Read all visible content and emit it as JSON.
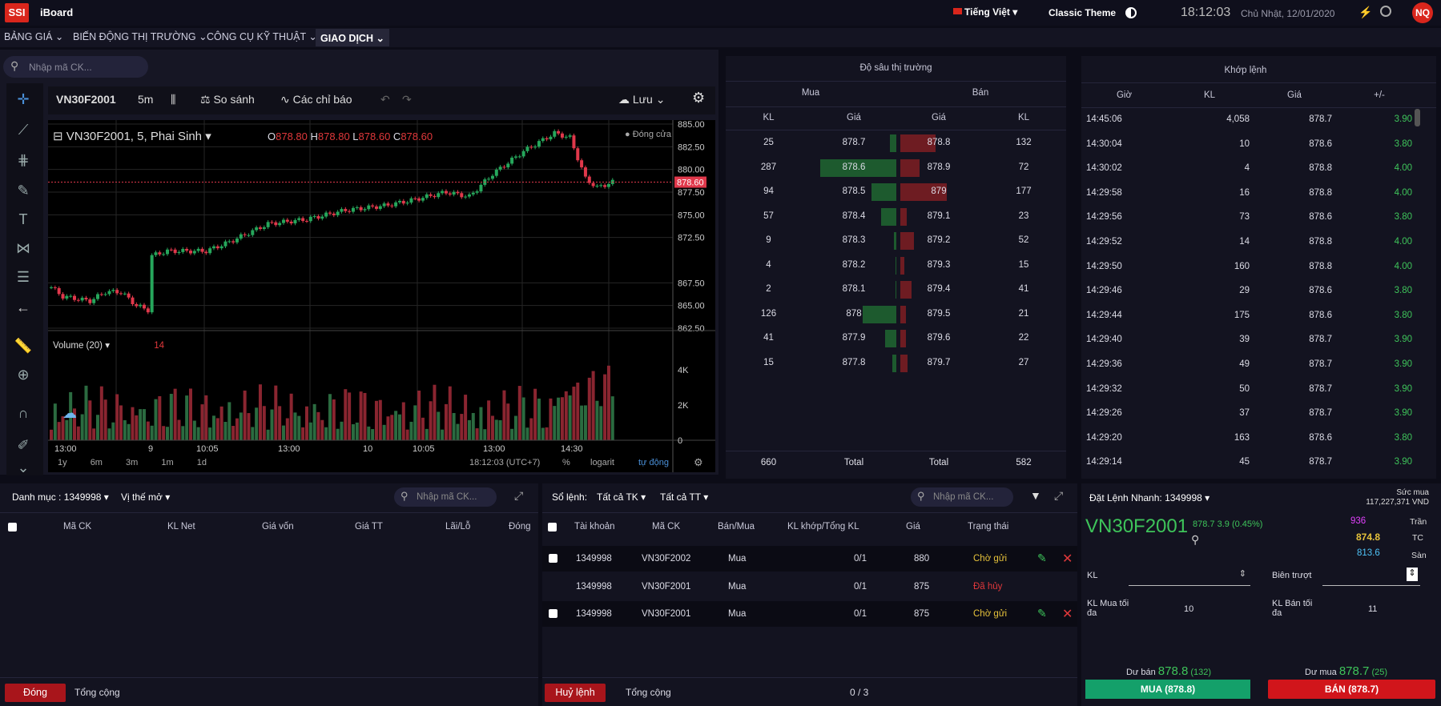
{
  "header": {
    "logo": "SSI",
    "brand": "iBoard",
    "language": "Tiếng Việt",
    "theme": "Classic Theme",
    "time": "18:12:03",
    "date": "Chủ Nhật, 12/01/2020",
    "avatar": "NQ"
  },
  "nav": [
    "BẢNG GIÁ",
    "BIẾN ĐỘNG THỊ TRƯỜNG",
    "CÔNG CỤ KỸ THUẬT",
    "GIAO DỊCH"
  ],
  "chart": {
    "search_placeholder": "Nhập mã CK...",
    "symbol": "VN30F2001",
    "interval": "5m",
    "compare": "So sánh",
    "indicators": "Các chỉ báo",
    "save": "Lưu",
    "legend_title": "VN30F2001, 5, Phai Sinh",
    "ohlc": {
      "o_label": "O",
      "o": "878.80",
      "h_label": "H",
      "h": "878.80",
      "l_label": "L",
      "l": "878.60",
      "c_label": "C",
      "c": "878.60"
    },
    "market_status": "Đóng cửa",
    "last_price": "878.60",
    "price_ticks": [
      "885.00",
      "882.50",
      "880.00",
      "877.50",
      "875.00",
      "872.50",
      "867.50",
      "865.00",
      "862.50"
    ],
    "volume_label": "Volume (20)",
    "volume_value": "14",
    "volume_ticks": [
      "4K",
      "2K",
      "0"
    ],
    "time_ticks": [
      "13:00",
      "9",
      "10:05",
      "13:00",
      "10",
      "10:05",
      "13:00",
      "14:30"
    ],
    "ranges": [
      "1y",
      "6m",
      "3m",
      "1m",
      "1d"
    ],
    "status_time": "18:12:03 (UTC+7)",
    "percent": "%",
    "log": "logarit",
    "auto": "tự động",
    "colors": {
      "up": "#26a65b",
      "down": "#e0384b"
    }
  },
  "depth": {
    "title": "Độ sâu thị trường",
    "buy": "Mua",
    "sell": "Bán",
    "cols": [
      "KL",
      "Giá",
      "Giá",
      "KL"
    ],
    "rows": [
      {
        "bkl": "25",
        "bp": "878.7",
        "sp": "878.8",
        "skl": "132"
      },
      {
        "bkl": "287",
        "bp": "878.6",
        "sp": "878.9",
        "skl": "72"
      },
      {
        "bkl": "94",
        "bp": "878.5",
        "sp": "879",
        "skl": "177"
      },
      {
        "bkl": "57",
        "bp": "878.4",
        "sp": "879.1",
        "skl": "23"
      },
      {
        "bkl": "9",
        "bp": "878.3",
        "sp": "879.2",
        "skl": "52"
      },
      {
        "bkl": "4",
        "bp": "878.2",
        "sp": "879.3",
        "skl": "15"
      },
      {
        "bkl": "2",
        "bp": "878.1",
        "sp": "879.4",
        "skl": "41"
      },
      {
        "bkl": "126",
        "bp": "878",
        "sp": "879.5",
        "skl": "21"
      },
      {
        "bkl": "41",
        "bp": "877.9",
        "sp": "879.6",
        "skl": "22"
      },
      {
        "bkl": "15",
        "bp": "877.8",
        "sp": "879.7",
        "skl": "27"
      }
    ],
    "footer": {
      "buy_total": "660",
      "buy_label": "Total",
      "sell_label": "Total",
      "sell_total": "582"
    }
  },
  "match": {
    "title": "Khớp lệnh",
    "cols": [
      "Giờ",
      "KL",
      "Giá",
      "+/-"
    ],
    "rows": [
      [
        "14:45:06",
        "4,058",
        "878.7",
        "3.90"
      ],
      [
        "14:30:04",
        "10",
        "878.6",
        "3.80"
      ],
      [
        "14:30:02",
        "4",
        "878.8",
        "4.00"
      ],
      [
        "14:29:58",
        "16",
        "878.8",
        "4.00"
      ],
      [
        "14:29:56",
        "73",
        "878.6",
        "3.80"
      ],
      [
        "14:29:52",
        "14",
        "878.8",
        "4.00"
      ],
      [
        "14:29:50",
        "160",
        "878.8",
        "4.00"
      ],
      [
        "14:29:46",
        "29",
        "878.6",
        "3.80"
      ],
      [
        "14:29:44",
        "175",
        "878.6",
        "3.80"
      ],
      [
        "14:29:40",
        "39",
        "878.7",
        "3.90"
      ],
      [
        "14:29:36",
        "49",
        "878.7",
        "3.90"
      ],
      [
        "14:29:32",
        "50",
        "878.7",
        "3.90"
      ],
      [
        "14:29:26",
        "37",
        "878.7",
        "3.90"
      ],
      [
        "14:29:20",
        "163",
        "878.6",
        "3.80"
      ],
      [
        "14:29:14",
        "45",
        "878.7",
        "3.90"
      ]
    ]
  },
  "portfolio": {
    "category": "Danh mục : 1349998",
    "open_position": "Vị thế mở",
    "search_placeholder": "Nhập mã CK...",
    "cols": [
      "Mã CK",
      "KL Net",
      "Giá vốn",
      "Giá TT",
      "Lãi/Lỗ",
      "Đóng"
    ],
    "close_button": "Đóng",
    "total": "Tổng cộng"
  },
  "orders": {
    "label": "Sổ lệnh:",
    "account_filter": "Tất cả TK",
    "status_filter": "Tất cả TT",
    "search_placeholder": "Nhập mã CK...",
    "cols": [
      "Tài khoản",
      "Mã CK",
      "Bán/Mua",
      "KL khớp/Tổng KL",
      "Giá",
      "Trạng thái"
    ],
    "rows": [
      {
        "acct": "1349998",
        "sym": "VN30F2002",
        "side": "Mua",
        "qty": "0/1",
        "price": "880",
        "status": "Chờ gửi"
      },
      {
        "acct": "1349998",
        "sym": "VN30F2001",
        "side": "Mua",
        "qty": "0/1",
        "price": "875",
        "status": "Đã hủy"
      },
      {
        "acct": "1349998",
        "sym": "VN30F2001",
        "side": "Mua",
        "qty": "0/1",
        "price": "875",
        "status": "Chờ gửi"
      }
    ],
    "cancel_button": "Huỷ lệnh",
    "total": "Tổng cộng",
    "count": "0 / 3"
  },
  "quick": {
    "title": "Đặt Lệnh Nhanh:",
    "account": "1349998",
    "buying_power_label": "Sức mua",
    "buying_power": "117,227,371 VND",
    "symbol": "VN30F2001",
    "price": "878.7",
    "change": "3.9 (0.45%)",
    "ceiling": "936",
    "ceiling_label": "Trần",
    "ref": "874.8",
    "ref_label": "TC",
    "floor": "813.6",
    "floor_label": "Sàn",
    "kl_label": "KL",
    "slip_label": "Biên trượt",
    "kl_max_buy_label": "KL Mua tối đa",
    "kl_max_buy": "10",
    "kl_max_sell_label": "KL Bán tối đa",
    "kl_max_sell": "11",
    "best_sell_label": "Dư bán",
    "best_sell": "878.8",
    "best_sell_qty": "(132)",
    "best_buy_label": "Dư mua",
    "best_buy": "878.7",
    "best_buy_qty": "(25)",
    "buy_button": "MUA (878.8)",
    "sell_button": "BÁN (878.7)"
  }
}
